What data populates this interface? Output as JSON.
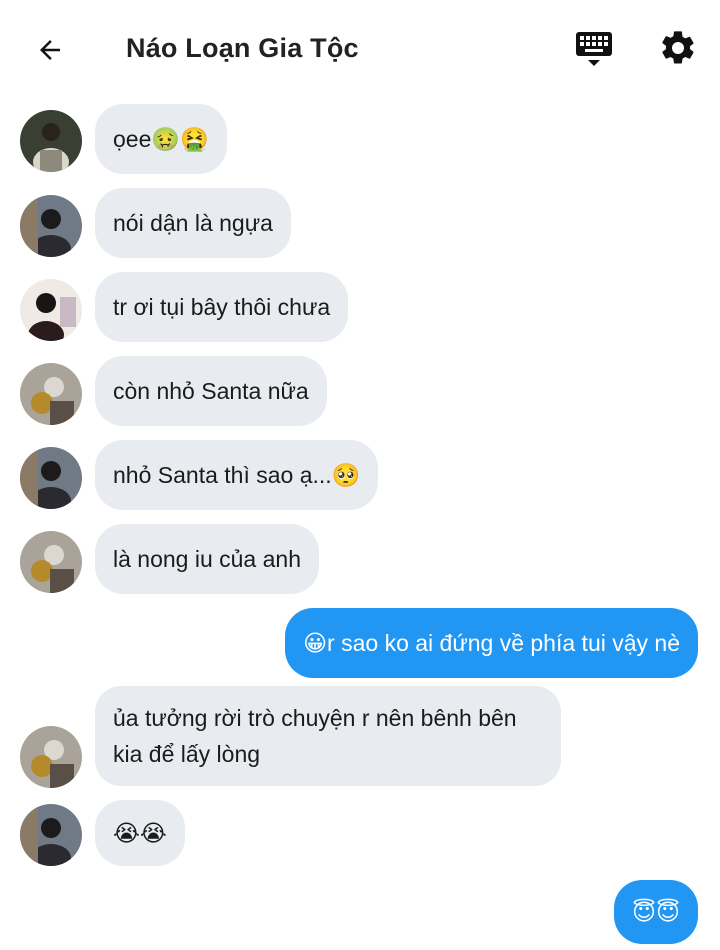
{
  "header": {
    "title": "Náo Loạn Gia Tộc",
    "back_icon": "arrow-left-icon",
    "keyboard_icon": "keyboard-icon",
    "settings_icon": "gear-icon"
  },
  "colors": {
    "incoming_bubble": "#e8ebf0",
    "outgoing_bubble": "#2196f3"
  },
  "messages": [
    {
      "sender": "other",
      "text": "ọee🤢🤮"
    },
    {
      "sender": "other",
      "text": "nói dận là ngựa"
    },
    {
      "sender": "other",
      "text": "tr ơi tụi bây thôi chưa"
    },
    {
      "sender": "other",
      "text": "còn nhỏ Santa nữa"
    },
    {
      "sender": "other",
      "text": "nhỏ Santa thì sao ạ...🥺"
    },
    {
      "sender": "other",
      "text": "là nong iu của anh"
    },
    {
      "sender": "me",
      "text": "😀r sao ko ai đứng về phía tui vậy nè"
    },
    {
      "sender": "other",
      "text": "ủa tưởng rời trò chuyện r nên bênh bên kia để lấy lòng"
    },
    {
      "sender": "other",
      "text": "😭😭"
    },
    {
      "sender": "me",
      "text": "😇😇"
    }
  ]
}
